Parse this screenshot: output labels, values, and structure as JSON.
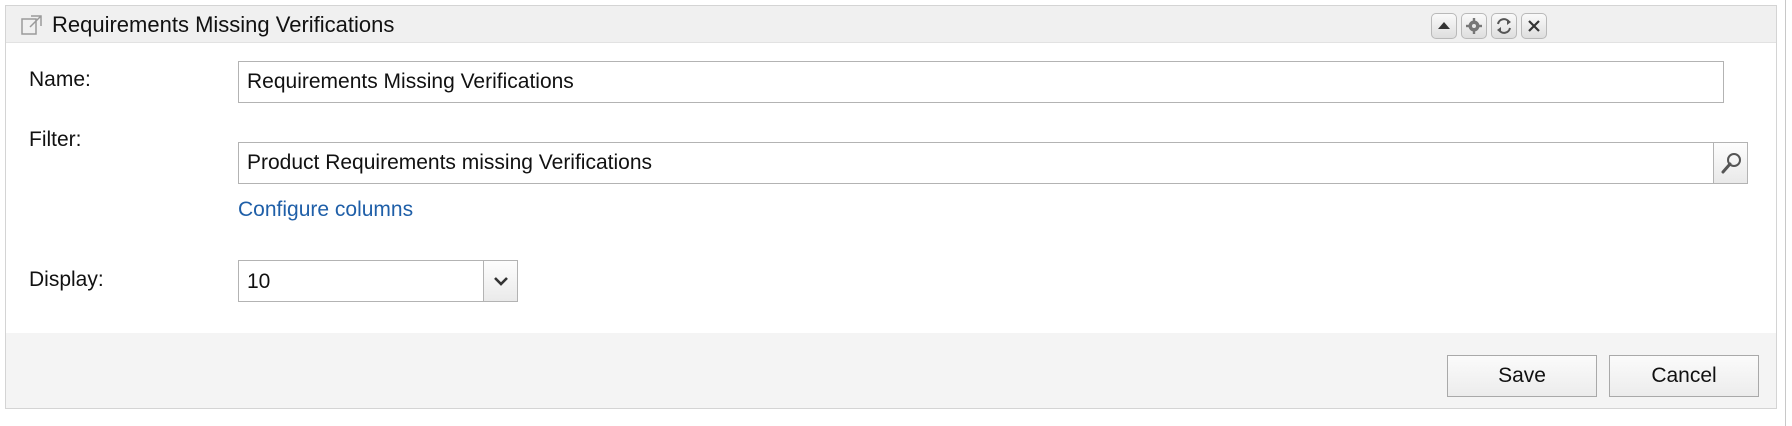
{
  "panel": {
    "title": "Requirements Missing Verifications",
    "header_icons": [
      "external-link-icon",
      "collapse-up-icon",
      "gear-icon",
      "refresh-icon",
      "close-icon"
    ]
  },
  "form": {
    "name_label": "Name:",
    "name_value": "Requirements Missing Verifications",
    "filter_label": "Filter:",
    "filter_value": "Product Requirements missing Verifications",
    "configure_columns_label": "Configure columns",
    "display_label": "Display:",
    "display_value": "10"
  },
  "footer": {
    "save_label": "Save",
    "cancel_label": "Cancel"
  },
  "colors": {
    "link": "#1f5fa8",
    "header_bg": "#f0f0f0",
    "footer_bg": "#f4f4f4",
    "border": "#b3b3b3"
  }
}
